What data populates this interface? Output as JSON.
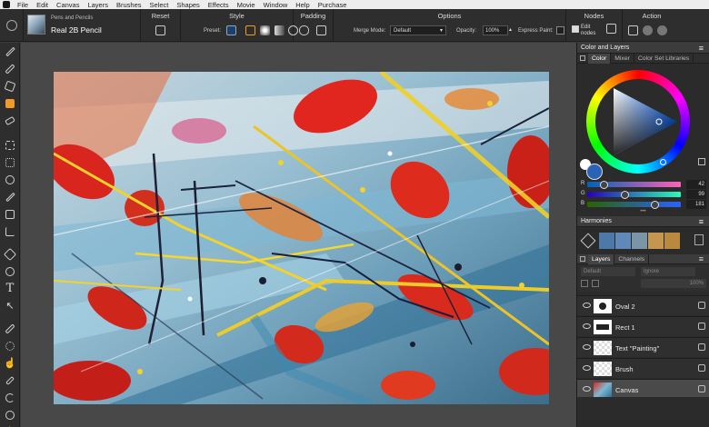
{
  "menu": [
    "File",
    "Edit",
    "Canvas",
    "Layers",
    "Brushes",
    "Select",
    "Shapes",
    "Effects",
    "Movie",
    "Window",
    "Help",
    "Purchase"
  ],
  "brush": {
    "category": "Pens and Pencils",
    "name": "Real 2B Pencil"
  },
  "groups": {
    "reset": "Reset",
    "style": "Style",
    "padding": "Padding",
    "options": "Options",
    "nodes": "Nodes",
    "action": "Action"
  },
  "style": {
    "preset_label": "Preset:"
  },
  "options": {
    "merge_label": "Merge Mode:",
    "merge_value": "Default",
    "opacity_label": "Opacity:",
    "opacity_value": "100%",
    "express_label": "Express Paint:"
  },
  "nodes": {
    "edit_label": "Edit nodes"
  },
  "color_panel": {
    "title": "Color and Layers",
    "tabs": [
      "Color",
      "Mixer",
      "Color Set Libraries"
    ],
    "channels": [
      {
        "label": "R",
        "value": "42",
        "pos": 0.16
      },
      {
        "label": "G",
        "value": "99",
        "pos": 0.39
      },
      {
        "label": "B",
        "value": "181",
        "pos": 0.71
      }
    ]
  },
  "harmonies": {
    "title": "Harmonies",
    "swatches": [
      "#4d79a8",
      "#5e89b8",
      "#7a95a8",
      "#c49650",
      "#b8893f"
    ]
  },
  "layers_panel": {
    "tabs": [
      "Layers",
      "Channels"
    ],
    "blend_mode": "Default",
    "ignore": "Ignore",
    "opacity": "100%",
    "layers": [
      {
        "name": "Oval 2"
      },
      {
        "name": "Rect 1"
      },
      {
        "name": "Text \"Painting\""
      },
      {
        "name": "Brush"
      },
      {
        "name": "Canvas"
      }
    ]
  },
  "colors": {
    "accent": "#f09a2a",
    "primary": "#2a63b5"
  }
}
